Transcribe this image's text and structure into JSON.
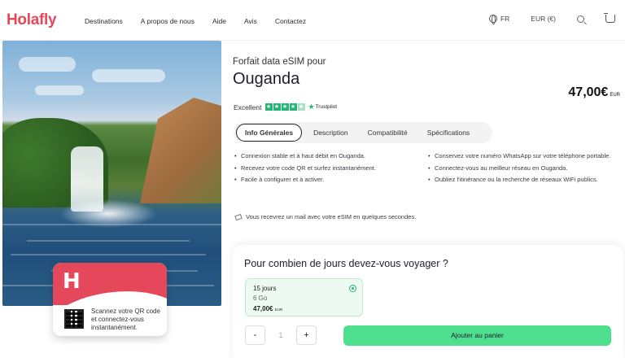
{
  "header": {
    "logo": "Holafly",
    "nav": [
      "Destinations",
      "A propos de nous",
      "Aide",
      "Avis",
      "Contactez"
    ],
    "language": "FR",
    "currency": "EUR (€)"
  },
  "product": {
    "subtitle": "Forfait data eSIM pour",
    "country": "Ouganda",
    "price": "47,00€",
    "price_currency": "EUR",
    "rating_label": "Excellent",
    "trustpilot": "Trustpilot",
    "tabs": [
      "Info Générales",
      "Description",
      "Compatibilité",
      "Spécifications"
    ],
    "active_tab": 0,
    "bullets_left": [
      "Connexion stable et à haut débit en Ouganda.",
      "Recevez votre code QR et surfez instantanément.",
      "Facile à configurer et à activer."
    ],
    "bullets_right": [
      "Conservez votre numéro WhatsApp sur votre téléphone portable.",
      "Connectez-vous au meilleur réseau en Ouganda.",
      "Oubliez l'itinérance ou la recherche de réseaux WiFi publics."
    ],
    "mail_note": "Vous recevrez un mail avec votre eSIM en quelques secondes."
  },
  "card": {
    "scan_text": "Scannez votre QR code et connectez-vous instantanément."
  },
  "booking": {
    "question": "Pour combien de jours devez-vous voyager ?",
    "plan": {
      "days": "15 jours",
      "data": "6 Go",
      "price": "47,00€",
      "currency": "EUR",
      "selected": true
    },
    "quantity": "1",
    "minus": "-",
    "plus": "+",
    "add_to_cart": "Ajouter au panier"
  },
  "colors": {
    "brand": "#e5485a",
    "accent_green": "#4ee08f",
    "trustpilot_green": "#22b574"
  }
}
